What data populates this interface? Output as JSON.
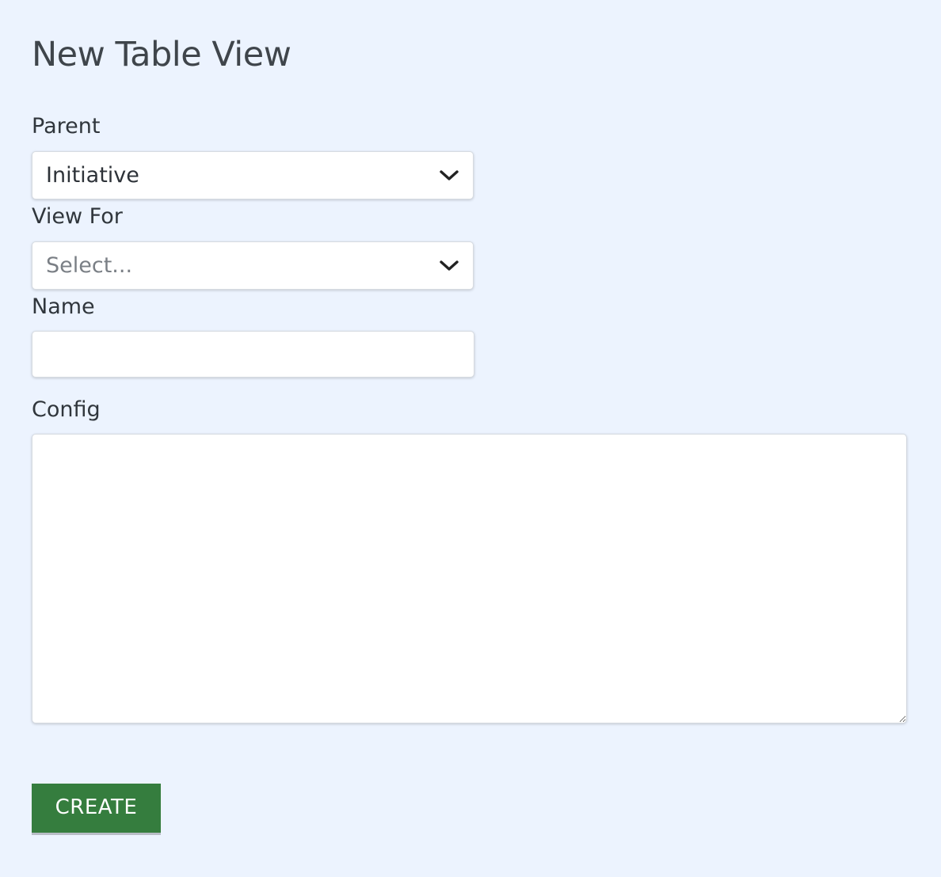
{
  "page": {
    "title": "New Table View"
  },
  "form": {
    "parent": {
      "label": "Parent",
      "selected_value": "Initiative",
      "icon": "chevron-down-icon"
    },
    "view_for": {
      "label": "View For",
      "placeholder": "Select...",
      "icon": "chevron-down-icon"
    },
    "name": {
      "label": "Name",
      "value": ""
    },
    "config": {
      "label": "Config",
      "value": ""
    },
    "create_label": "CREATE"
  },
  "colors": {
    "page_background": "#ecf3fe",
    "button_background": "#357d3e",
    "button_text": "#ffffff"
  }
}
